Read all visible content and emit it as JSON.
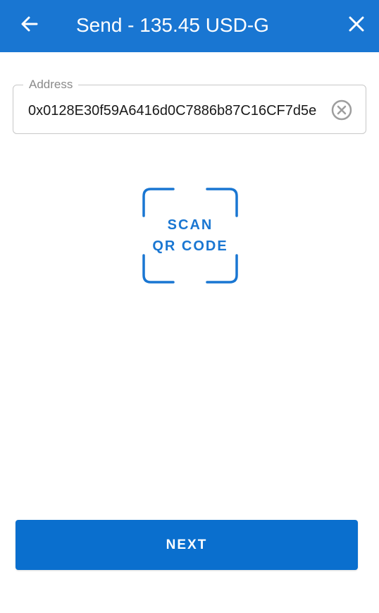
{
  "app_bar": {
    "title": "Send - 135.45 USD-G",
    "back_icon": "arrow-left-icon",
    "close_icon": "close-icon",
    "background_color": "#1976d2"
  },
  "address": {
    "label": "Address",
    "value": "0x0128E30f59A6416d0C7886b87C16CF7d5e",
    "clear_icon": "clear-circle-icon"
  },
  "scan": {
    "line1": "SCAN",
    "line2": "QR CODE",
    "icon": "qr-scan-frame-icon",
    "color": "#1976d2"
  },
  "next": {
    "label": "NEXT",
    "color": "#0a6fce"
  }
}
